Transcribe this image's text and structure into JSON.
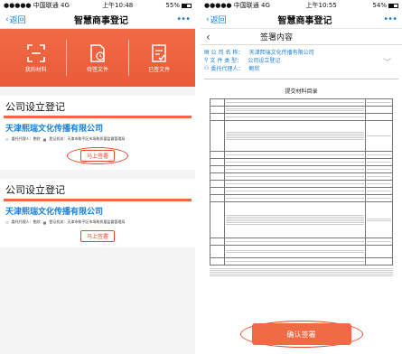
{
  "left": {
    "status": {
      "carrier": "●●●●● 中国联通",
      "network": "4G",
      "time": "上午10:48",
      "battery": "55%"
    },
    "nav": {
      "back": "返回",
      "title": "智慧商事登记",
      "more": "•••"
    },
    "banner": [
      {
        "label": "我的材料",
        "icon": "scan-icon"
      },
      {
        "label": "待签文件",
        "icon": "pending-doc-icon"
      },
      {
        "label": "已签文件",
        "icon": "signed-doc-icon"
      }
    ],
    "cards": [
      {
        "title": "公司设立登记",
        "company": "天津熙瑞文化传播有限公司",
        "agent": "委托代理人：鲍欣",
        "authority": "登记机关：天津市和平区市场和质量监督管理局",
        "button": "马上签署"
      },
      {
        "title": "公司设立登记",
        "company": "天津熙瑞文化传播有限公司",
        "agent": "委托代理人：鲍欣",
        "authority": "登记机关：天津市和平区市场和质量监督管理局",
        "button": "马上签署"
      }
    ]
  },
  "right": {
    "status": {
      "carrier": "●●●●● 中国联通",
      "network": "4G",
      "time": "上午10:55",
      "battery": "54%"
    },
    "nav": {
      "back": "返回",
      "title": "智慧商事登记",
      "more": "•••"
    },
    "header": "签署内容",
    "info": {
      "company_label": "公 司 名 称：",
      "company_value": "天津熙瑞文化传播有限公司",
      "type_label": "文 件 类 型：",
      "type_value": "公司设立登记",
      "agent_label": "委托代理人：",
      "agent_value": "鲍欣"
    },
    "doc_title": "提交材料目录",
    "confirm": "确认签署"
  }
}
